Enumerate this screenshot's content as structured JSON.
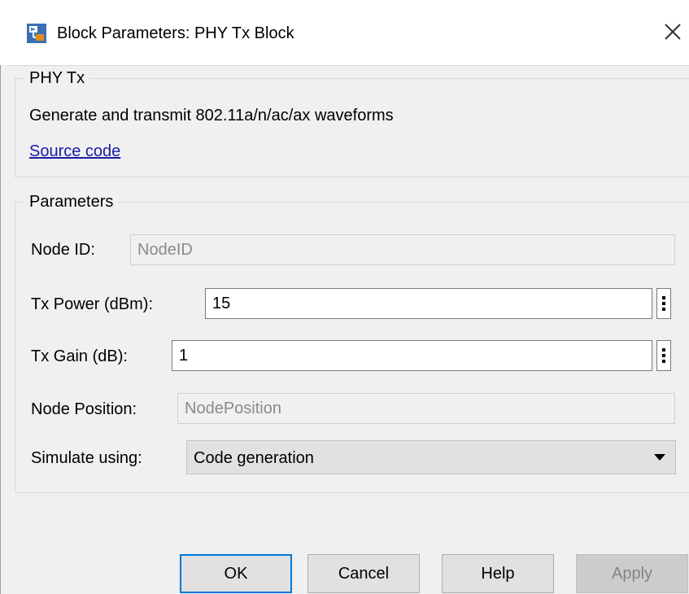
{
  "window": {
    "title": "Block Parameters: PHY Tx Block",
    "icon": "simulink-block-icon",
    "close_icon": "close-icon"
  },
  "phy_group": {
    "legend": "PHY Tx",
    "description": "Generate and transmit 802.11a/n/ac/ax waveforms",
    "link": "Source code"
  },
  "params_group": {
    "legend": "Parameters",
    "node_id": {
      "label": "Node ID:",
      "placeholder": "NodeID"
    },
    "tx_power": {
      "label": "Tx Power (dBm):",
      "value": "15"
    },
    "tx_gain": {
      "label": "Tx Gain (dB):",
      "value": "1"
    },
    "node_position": {
      "label": "Node Position:",
      "placeholder": "NodePosition"
    },
    "simulate_using": {
      "label": "Simulate using:",
      "value": "Code generation"
    }
  },
  "buttons": {
    "ok": "OK",
    "cancel": "Cancel",
    "help": "Help",
    "apply": "Apply"
  },
  "colors": {
    "link": "#1a1aa8",
    "default_button_border": "#0078d7"
  }
}
